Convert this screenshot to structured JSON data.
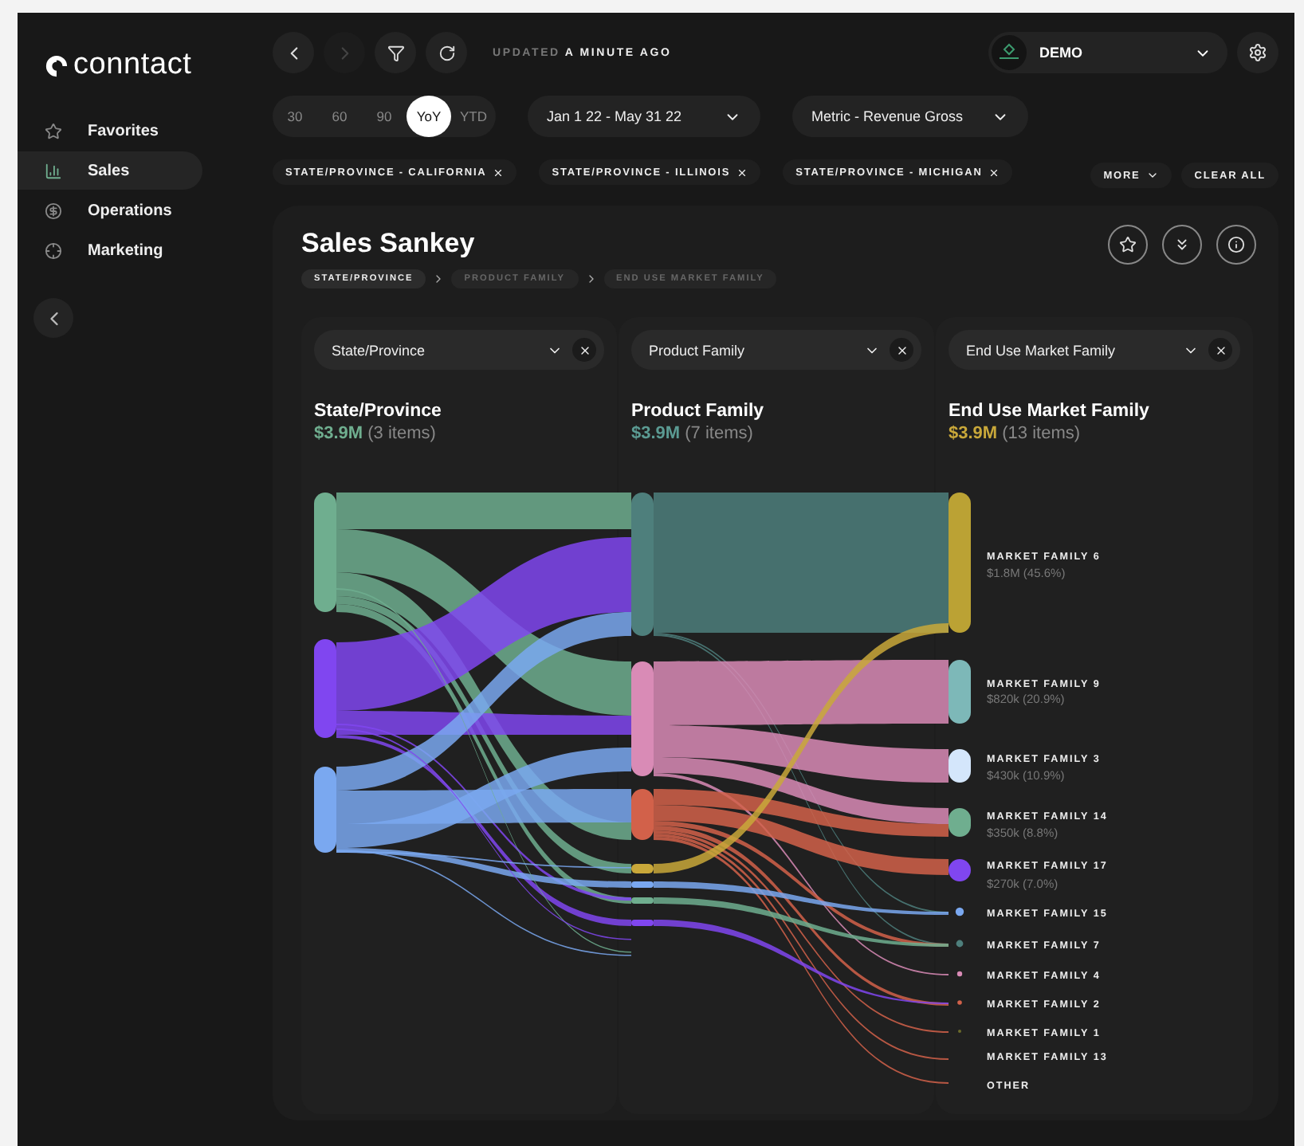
{
  "brand": "conntact",
  "sidebar": {
    "items": [
      {
        "label": "Favorites",
        "selected": false
      },
      {
        "label": "Sales",
        "selected": true
      },
      {
        "label": "Operations",
        "selected": false
      },
      {
        "label": "Marketing",
        "selected": false
      }
    ]
  },
  "toolbar": {
    "updated_label": "UPDATED",
    "updated_value": "A MINUTE AGO",
    "account": "DEMO"
  },
  "ranges": [
    {
      "label": "30",
      "selected": false
    },
    {
      "label": "60",
      "selected": false
    },
    {
      "label": "90",
      "selected": false
    },
    {
      "label": "YoY",
      "selected": true
    },
    {
      "label": "YTD",
      "selected": false
    }
  ],
  "date_range": "Jan 1 22 - May 31 22",
  "metric": "Metric - Revenue Gross",
  "filters": [
    "STATE/PROVINCE - CALIFORNIA",
    "STATE/PROVINCE - ILLINOIS",
    "STATE/PROVINCE - MICHIGAN"
  ],
  "more": "MORE",
  "clear_all": "CLEAR ALL",
  "card": {
    "title": "Sales Sankey",
    "breadcrumbs": [
      {
        "label": "STATE/PROVINCE",
        "selected": true
      },
      {
        "label": "PRODUCT FAMILY",
        "selected": false
      },
      {
        "label": "END USE MARKET FAMILY",
        "selected": false
      }
    ],
    "columns": [
      {
        "selector": "State/Province",
        "title": "State/Province",
        "total": "$3.9M",
        "color": "#6fae8f",
        "count": "(3 items)",
        "nodes": [
          {
            "color": "#6fae8f"
          },
          {
            "color": "#8046f0"
          },
          {
            "color": "#7aa8f0"
          }
        ]
      },
      {
        "selector": "Product Family",
        "title": "Product Family",
        "total": "$3.9M",
        "color": "#5b9b93",
        "count": "(7 items)",
        "nodes": [
          {
            "color": "#4e7f7c"
          },
          {
            "color": "#d98bb6"
          },
          {
            "color": "#d2614a"
          },
          {
            "color": "#c9a83a"
          },
          {
            "color": "#7aa8f0"
          },
          {
            "color": "#6fae8f"
          },
          {
            "color": "#8046f0"
          }
        ]
      },
      {
        "selector": "End Use Market Family",
        "title": "End Use Market Family",
        "total": "$3.9M",
        "color": "#c9a83a",
        "count": "(13 items)",
        "nodes": [
          {
            "label": "MARKET FAMILY 6",
            "value": "$1.8M (45.6%)",
            "color": "#bba234"
          },
          {
            "label": "MARKET FAMILY 9",
            "value": "$820k (20.9%)",
            "color": "#7db8b8"
          },
          {
            "label": "MARKET FAMILY 3",
            "value": "$430k (10.9%)",
            "color": "#d4e6fb"
          },
          {
            "label": "MARKET FAMILY 14",
            "value": "$350k (8.8%)",
            "color": "#6fae8f"
          },
          {
            "label": "MARKET FAMILY 17",
            "value": "$270k (7.0%)",
            "color": "#8046f0"
          },
          {
            "label": "MARKET FAMILY 15",
            "color": "#7aa8f0"
          },
          {
            "label": "MARKET FAMILY 7",
            "color": "#4e7f7c"
          },
          {
            "label": "MARKET FAMILY 4",
            "color": "#d98bb6"
          },
          {
            "label": "MARKET FAMILY 2",
            "color": "#d2614a"
          },
          {
            "label": "MARKET FAMILY 1",
            "color": "#6b6a2a"
          },
          {
            "label": "MARKET FAMILY 13"
          },
          {
            "label": "OTHER"
          }
        ]
      }
    ]
  }
}
